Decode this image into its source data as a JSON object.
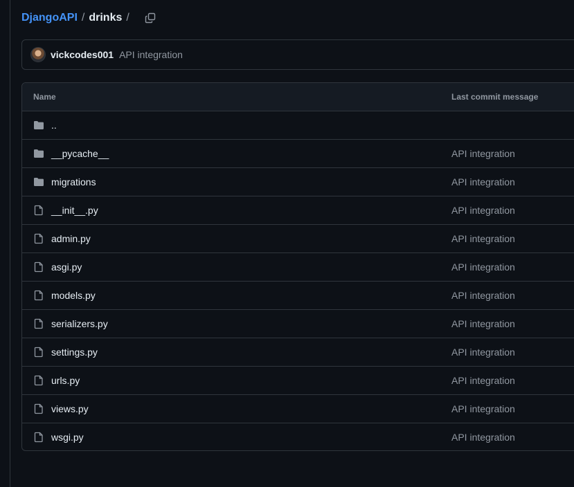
{
  "breadcrumb": {
    "repo": "DjangoAPI",
    "separator": "/",
    "dir": "drinks",
    "trailing": "/"
  },
  "latest_commit": {
    "author": "vickcodes001",
    "message": "API integration"
  },
  "table": {
    "headers": {
      "name": "Name",
      "message": "Last commit message"
    },
    "parent_label": "..",
    "rows": [
      {
        "name": "__pycache__",
        "type": "folder",
        "message": "API integration"
      },
      {
        "name": "migrations",
        "type": "folder",
        "message": "API integration"
      },
      {
        "name": "__init__.py",
        "type": "file",
        "message": "API integration"
      },
      {
        "name": "admin.py",
        "type": "file",
        "message": "API integration"
      },
      {
        "name": "asgi.py",
        "type": "file",
        "message": "API integration"
      },
      {
        "name": "models.py",
        "type": "file",
        "message": "API integration"
      },
      {
        "name": "serializers.py",
        "type": "file",
        "message": "API integration"
      },
      {
        "name": "settings.py",
        "type": "file",
        "message": "API integration"
      },
      {
        "name": "urls.py",
        "type": "file",
        "message": "API integration"
      },
      {
        "name": "views.py",
        "type": "file",
        "message": "API integration"
      },
      {
        "name": "wsgi.py",
        "type": "file",
        "message": "API integration"
      }
    ]
  },
  "colors": {
    "background": "#0d1117",
    "link": "#4493f8",
    "muted": "#9198a1",
    "border": "#30363d"
  }
}
